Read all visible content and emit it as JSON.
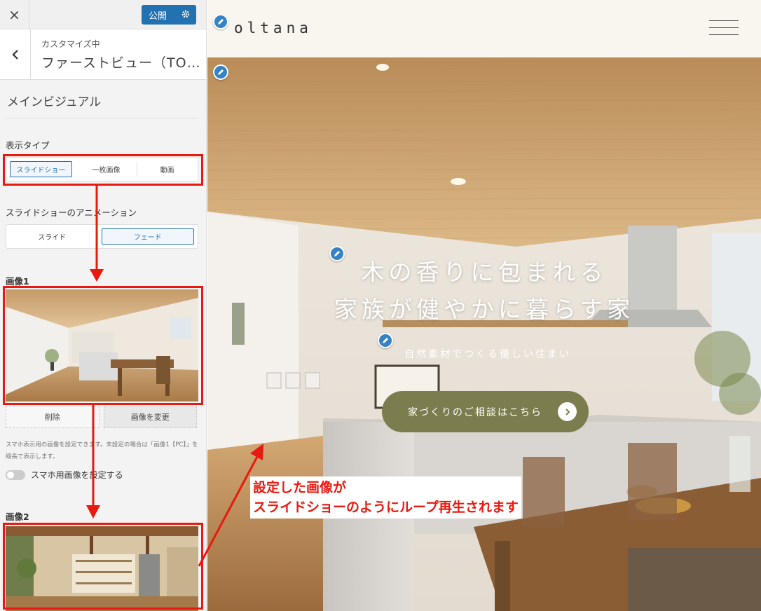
{
  "customizer": {
    "close_label": "×",
    "publish_label": "公開",
    "breadcrumb": "カスタマイズ中",
    "section_title": "ファーストビュー（TO…",
    "panel_heading": "メインビジュアル",
    "display_type": {
      "label": "表示タイプ",
      "options": [
        "スライドショー",
        "一枚画像",
        "動画"
      ],
      "selected": "スライドショー"
    },
    "animation": {
      "label": "スライドショーのアニメーション",
      "options": [
        "スライド",
        "フェード"
      ],
      "selected": "フェード"
    },
    "image1": {
      "label": "画像1",
      "remove_label": "削除",
      "change_label": "画像を変更",
      "note": "スマホ表示用の画像を設定できます。未設定の場合は「画像1【PC】」を縦長で表示します。",
      "toggle_label": "スマホ用画像を設定する"
    },
    "image2": {
      "label": "画像2"
    }
  },
  "preview": {
    "logo": "OLTANA",
    "hero_title_line1": "木の香りに包まれる",
    "hero_title_line2": "家族が健やかに暮らす家",
    "hero_subtitle": "自然素材でつくる優しい住まい",
    "cta_label": "家づくりのご相談はこちら"
  },
  "annotation": {
    "line1": "設定した画像が",
    "line2": "スライドショーのようにループ再生されます"
  },
  "colors": {
    "accent": "#2271b1",
    "annotation_red": "#e8190f",
    "cta_olive": "#7b7d4e"
  }
}
